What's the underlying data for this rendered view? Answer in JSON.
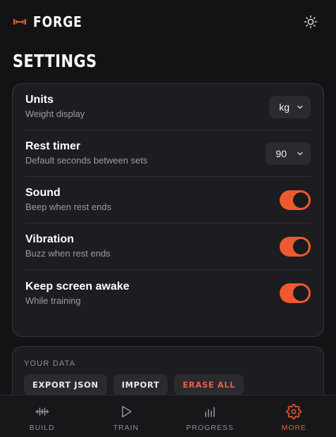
{
  "header": {
    "brand": "FORGE",
    "logo_icon": "dumbbell-icon",
    "theme_icon": "sun-icon"
  },
  "page": {
    "title": "SETTINGS"
  },
  "settings": {
    "units": {
      "title": "Units",
      "subtitle": "Weight display",
      "value": "kg"
    },
    "rest_timer": {
      "title": "Rest timer",
      "subtitle": "Default seconds between sets",
      "value": "90"
    },
    "sound": {
      "title": "Sound",
      "subtitle": "Beep when rest ends",
      "enabled": true
    },
    "vibration": {
      "title": "Vibration",
      "subtitle": "Buzz when rest ends",
      "enabled": true
    },
    "keep_awake": {
      "title": "Keep screen awake",
      "subtitle": "While training",
      "enabled": true
    }
  },
  "your_data": {
    "label": "YOUR DATA",
    "export_label": "EXPORT JSON",
    "import_label": "IMPORT",
    "erase_label": "ERASE ALL"
  },
  "tabbar": {
    "tabs": [
      {
        "label": "BUILD",
        "icon": "waveform-icon",
        "active": false
      },
      {
        "label": "TRAIN",
        "icon": "play-icon",
        "active": false
      },
      {
        "label": "PROGRESS",
        "icon": "bar-chart-icon",
        "active": false
      },
      {
        "label": "MORE",
        "icon": "gear-icon",
        "active": true
      }
    ]
  },
  "colors": {
    "accent": "#ee5a30",
    "background": "#131316",
    "card": "#1d1d21",
    "danger": "#ef5a4e"
  }
}
